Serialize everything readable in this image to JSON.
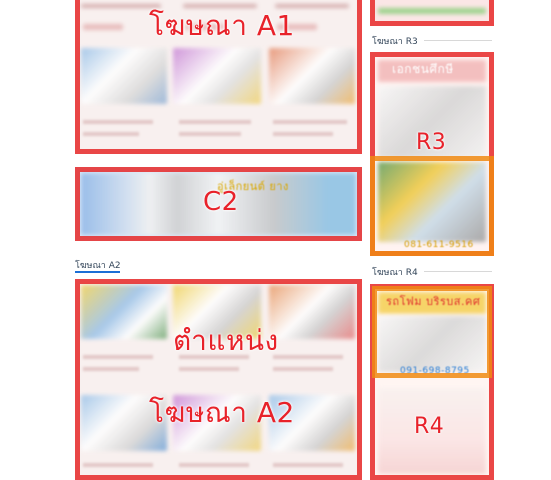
{
  "slots": {
    "a1": {
      "label": "โฆษณา A1"
    },
    "c2": {
      "label": "C2",
      "banner_text": "อู่เล็กยนต์ ยาง"
    },
    "a2": {
      "label_line1": "ตำแหน่ง",
      "label_line2": "โฆษณา A2"
    },
    "r3": {
      "label": "R3",
      "header_text": "เอกชนศึกษี",
      "footer_text": "081-611-9516"
    },
    "r4": {
      "label": "R4",
      "header_text": "รถโฟม บริรบส.คศ",
      "phone_text": "091-698-8795"
    }
  },
  "sidebar_labels": {
    "r3": "โฆษณา R3",
    "r4": "โฆษณา R4"
  },
  "main_labels": {
    "a2": "โฆษณา A2"
  },
  "colors": {
    "frame_red": "#e6282a",
    "label_red": "#e8222a",
    "underline_blue": "#1b6fd6",
    "r_frame_orange": "#f08a12"
  }
}
